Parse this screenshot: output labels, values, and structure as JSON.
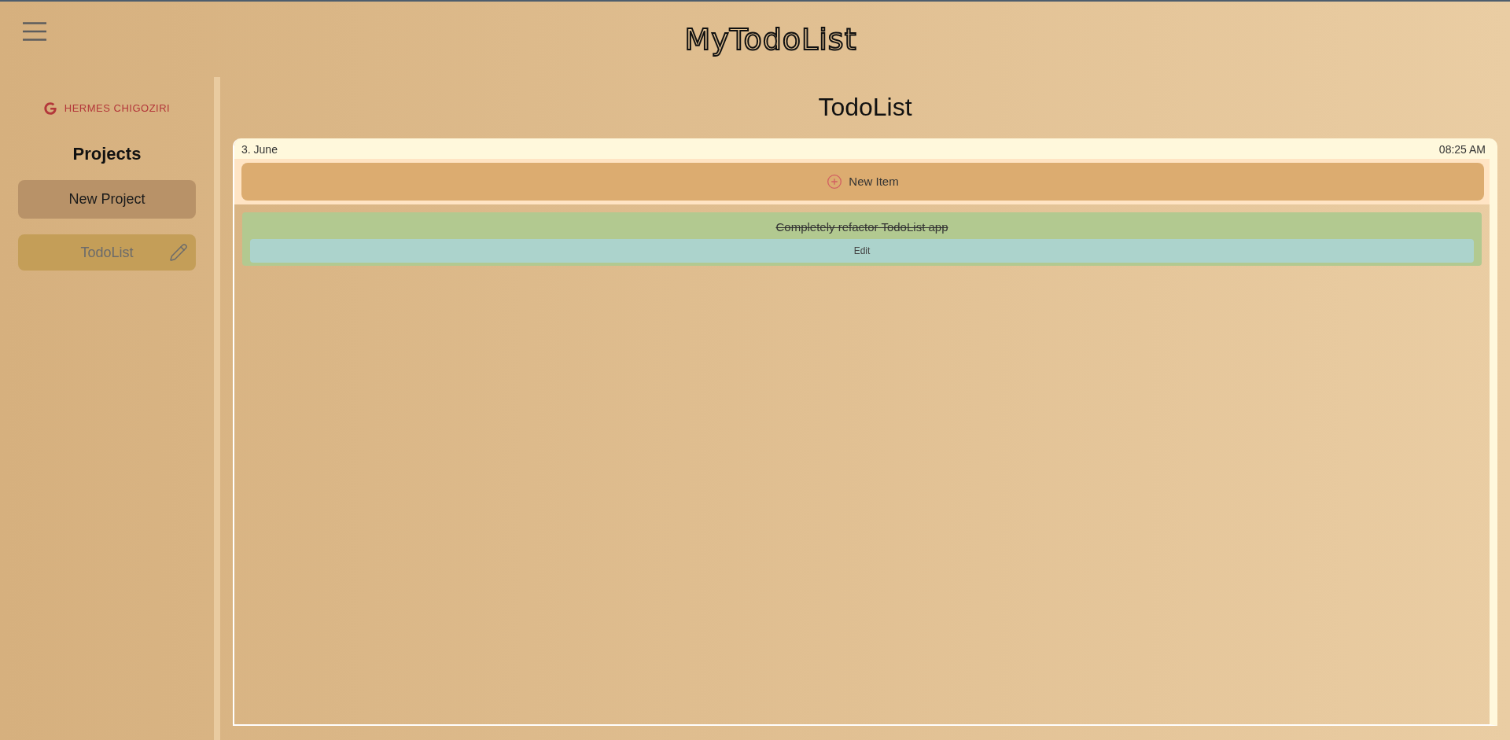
{
  "header": {
    "logo": "MyTodoList"
  },
  "sidebar": {
    "user": "HERMES CHIGOZIRI",
    "heading": "Projects",
    "new_project_button": "New Project",
    "projects": [
      {
        "name": "TodoList",
        "selected": true
      }
    ]
  },
  "main": {
    "title": "TodoList",
    "date": "3. June",
    "time": "08:25 AM",
    "new_item_button": "New Item",
    "items": [
      {
        "text": "Completely refactor TodoList app",
        "done": true,
        "edit_label": "Edit"
      }
    ]
  }
}
